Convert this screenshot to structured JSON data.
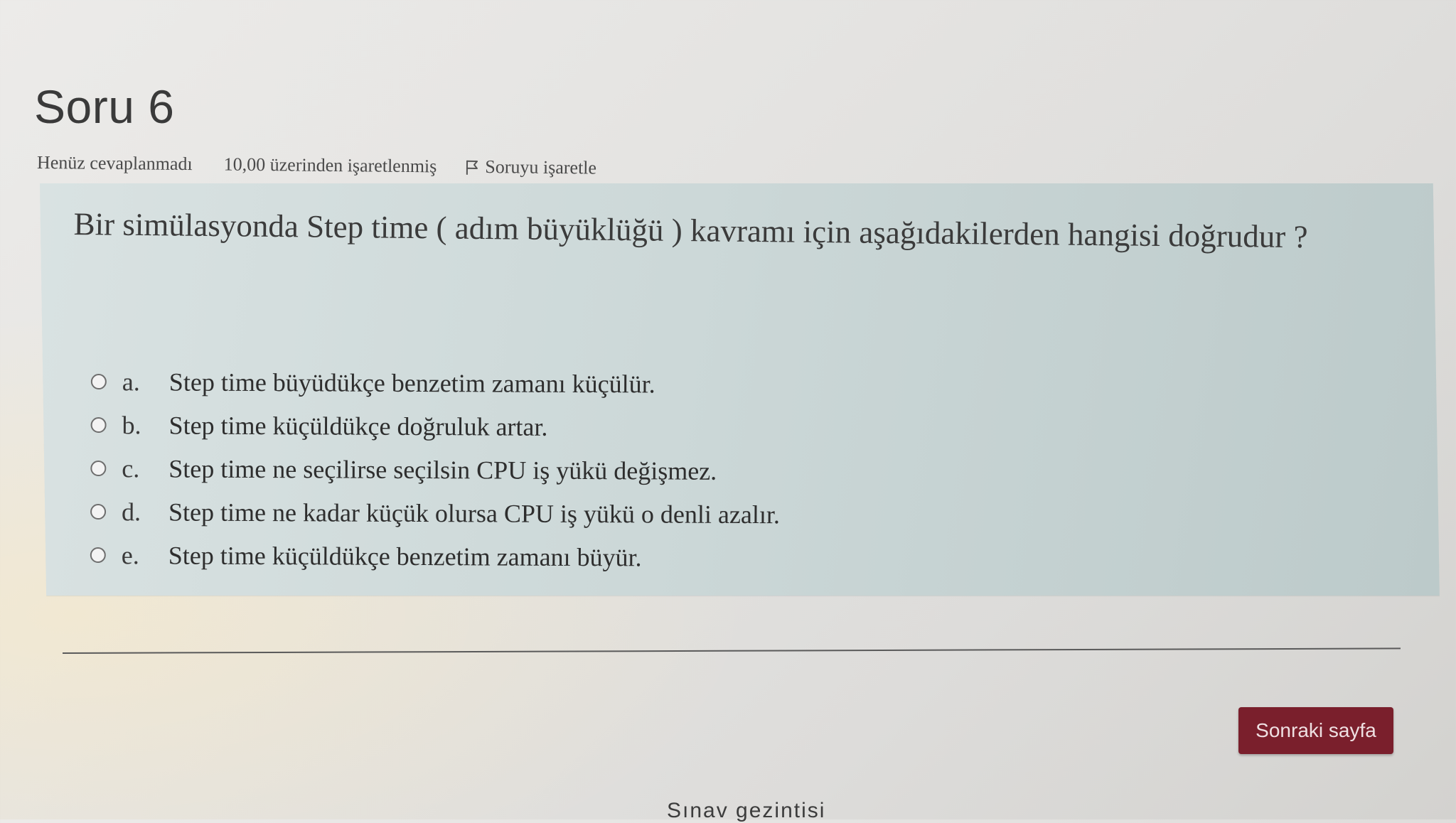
{
  "question": {
    "title": "Soru 6",
    "status": "Henüz cevaplanmadı",
    "grade": "10,00 üzerinden işaretlenmiş",
    "flag_label": "Soruyu işaretle",
    "flag_icon": "flag-icon",
    "text": "Bir simülasyonda Step time ( adım büyüklüğü ) kavramı için aşağıdakilerden hangisi doğrudur ?"
  },
  "answers": [
    {
      "letter": "a.",
      "text": "Step time büyüdükçe benzetim zamanı küçülür."
    },
    {
      "letter": "b.",
      "text": "Step time küçüldükçe doğruluk artar."
    },
    {
      "letter": "c.",
      "text": "Step time ne seçilirse seçilsin CPU iş yükü değişmez."
    },
    {
      "letter": "d.",
      "text": "Step time ne kadar küçük olursa CPU iş yükü o denli azalır."
    },
    {
      "letter": "e.",
      "text": "Step time küçüldükçe benzetim zamanı büyür."
    }
  ],
  "navigation": {
    "next_label": "Sonraki sayfa",
    "quiz_nav_heading": "Sınav gezintisi"
  },
  "colors": {
    "question_box": "#ccd8d8",
    "next_button": "#7a1f2c"
  }
}
